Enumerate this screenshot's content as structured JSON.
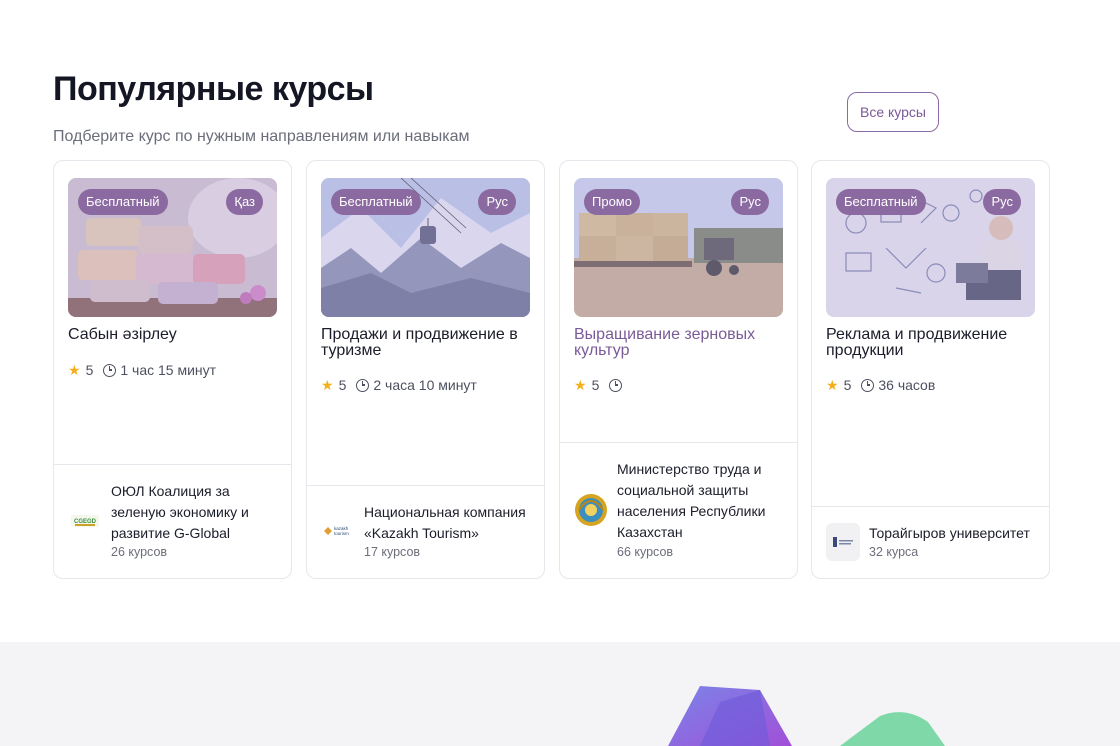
{
  "section": {
    "title": "Популярные курсы",
    "subtitle": "Подберите курс по нужным направлениям или навыкам",
    "all_courses_label": "Все курсы"
  },
  "courses": [
    {
      "badge_type": "Бесплатный",
      "badge_lang": "Қаз",
      "title": "Сабын әзірлеу",
      "rating": "5",
      "duration": "1 час 15 минут",
      "provider": "ОЮЛ Коалиция за зеленую экономику и развитие G-Global",
      "provider_courses": "26 курсов",
      "image": "handmade-soap-photo",
      "logo": "coalition-logo"
    },
    {
      "badge_type": "Бесплатный",
      "badge_lang": "Рус",
      "title": "Продажи и продвижение в туризме",
      "rating": "5",
      "duration": "2 часа 10 минут",
      "provider": "Национальная компания «Kazakh Tourism»",
      "provider_courses": "17 курсов",
      "image": "mountain-cable-car-photo",
      "logo": "kazakh-tourism-logo"
    },
    {
      "badge_type": "Промо",
      "badge_lang": "Рус",
      "title": "Выращивание зерновых культур",
      "rating": "5",
      "duration": "",
      "provider": "Министерство труда и социальной защиты населения Республики Казахстан",
      "provider_courses": "66 курсов",
      "image": "hay-bales-tractor-photo",
      "logo": "kazakhstan-emblem"
    },
    {
      "badge_type": "Бесплатный",
      "badge_lang": "Рус",
      "title": "Реклама и продвижение продукции",
      "rating": "5",
      "duration": "36 часов",
      "provider": "Торайгыров университет",
      "provider_courses": "32 курса",
      "image": "marketing-sketch-laptop-photo",
      "logo": "toraighyrov-university-logo"
    }
  ],
  "colors": {
    "accent": "#8a6aa0",
    "title_highlight": "#7a5a98",
    "star": "#f2b01e"
  }
}
